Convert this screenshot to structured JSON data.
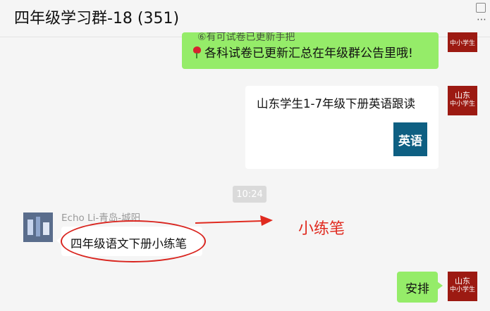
{
  "header": {
    "title": "四年级学习群-18 (351)",
    "more_icon": "⋯"
  },
  "messages": {
    "msg1": {
      "cut_text": "⑥有可试卷已更新手把",
      "text": "各科试卷已更新汇总在年级群公告里哦!",
      "icon": "rose-icon"
    },
    "card": {
      "title": "山东学生1-7年级下册英语跟读",
      "thumb_text": "英语"
    },
    "timestamp": "10:24",
    "incoming": {
      "sender": "Echo Li-青岛-城阳",
      "text": "四年级语文下册小练笔"
    },
    "annotation": "小练笔",
    "last": {
      "text": "安排"
    }
  },
  "self_avatar": {
    "line1": "山东",
    "line2": "中小学生"
  },
  "colors": {
    "own_bubble": "#95ec69",
    "avatar_brand": "#9c1a12",
    "annotation": "#e02a1f",
    "card_thumb": "#0e5f82"
  }
}
